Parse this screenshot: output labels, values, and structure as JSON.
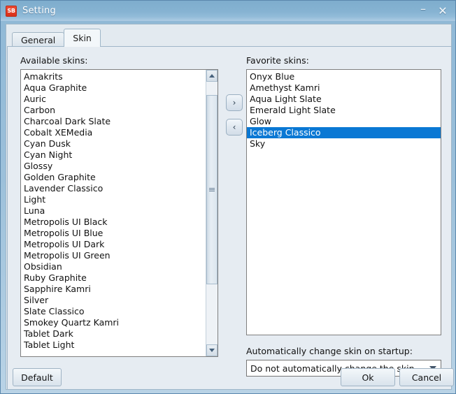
{
  "window": {
    "title": "Setting",
    "icon_label": "SB",
    "icon_name": "app-icon-sb",
    "controls": {
      "minimize": "–",
      "close": "✕"
    }
  },
  "tabs": [
    {
      "label": "General",
      "active": false
    },
    {
      "label": "Skin",
      "active": true
    }
  ],
  "available": {
    "label": "Available skins:",
    "items": [
      "Amakrits",
      "Aqua Graphite",
      "Auric",
      "Carbon",
      "Charcoal Dark Slate",
      "Cobalt XEMedia",
      "Cyan Dusk",
      "Cyan Night",
      "Glossy",
      "Golden Graphite",
      "Lavender Classico",
      "Light",
      "Luna",
      "Metropolis UI Black",
      "Metropolis UI Blue",
      "Metropolis UI Dark",
      "Metropolis UI Green",
      "Obsidian",
      "Ruby Graphite",
      "Sapphire Kamri",
      "Silver",
      "Slate Classico",
      "Smokey Quartz Kamri",
      "Tablet Dark",
      "Tablet Light"
    ],
    "selected_index": -1,
    "scrollbar": {
      "up_arrow": "up-arrow-icon",
      "down_arrow": "down-arrow-icon",
      "thumb_top_pct": 5,
      "thumb_height_pct": 72
    }
  },
  "transfer": {
    "add_label": "›",
    "remove_label": "‹"
  },
  "favorites": {
    "label": "Favorite skins:",
    "items": [
      "Onyx Blue",
      "Amethyst Kamri",
      "Aqua Light Slate",
      "Emerald Light Slate",
      "Glow",
      "Iceberg Classico",
      "Sky"
    ],
    "selected_index": 5,
    "selected_value": "Iceberg Classico"
  },
  "startup": {
    "label": "Automatically change skin on startup:",
    "selected_value": "Do not automatically change the skin"
  },
  "footer": {
    "default_label": "Default",
    "ok_label": "Ok",
    "cancel_label": "Cancel"
  },
  "colors": {
    "selection_blue": "#0a78d4",
    "titlebar_blue": "#86b3d2",
    "panel_bg": "#e6ecf2",
    "accent_red": "#d8301a"
  }
}
